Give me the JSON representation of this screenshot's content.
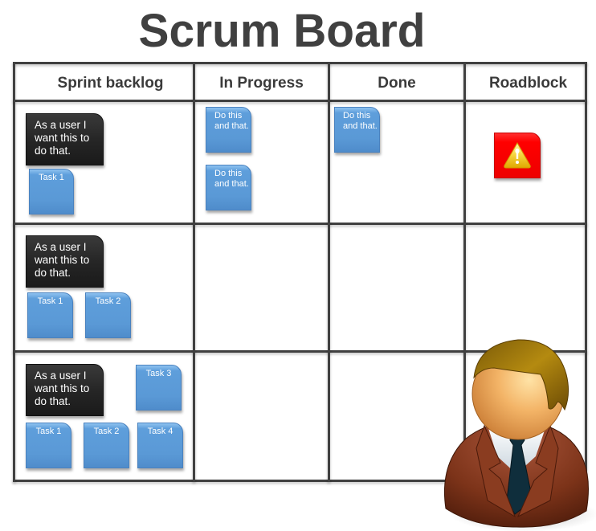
{
  "title": "Scrum Board",
  "columns": [
    {
      "label": "Sprint backlog"
    },
    {
      "label": "In Progress"
    },
    {
      "label": "Done"
    },
    {
      "label": "Roadblock"
    }
  ],
  "rows": [
    {
      "story": "As a user I want this to do that.",
      "backlog_tasks": [
        "Task 1"
      ],
      "in_progress": [
        "Do this and that.",
        "Do this and that."
      ],
      "done": [
        "Do this and that."
      ],
      "roadblock": {
        "icon": "warning-icon"
      }
    },
    {
      "story": "As a user I want this to do that.",
      "backlog_tasks": [
        "Task 1",
        "Task 2"
      ],
      "in_progress": [],
      "done": [],
      "roadblock": null
    },
    {
      "story": "As a user I want this to do that.",
      "backlog_tasks": [
        "Task 3",
        "Task 1",
        "Task 2",
        "Task 4"
      ],
      "in_progress": [],
      "done": [],
      "roadblock": null
    }
  ],
  "colors": {
    "grid": "#404040",
    "story_card": "#262626",
    "task_card": "#5b9bd5",
    "roadblock_card": "#ff0000",
    "warning_icon": "#f5c518"
  },
  "illustration": {
    "icon": "businessman-icon"
  }
}
